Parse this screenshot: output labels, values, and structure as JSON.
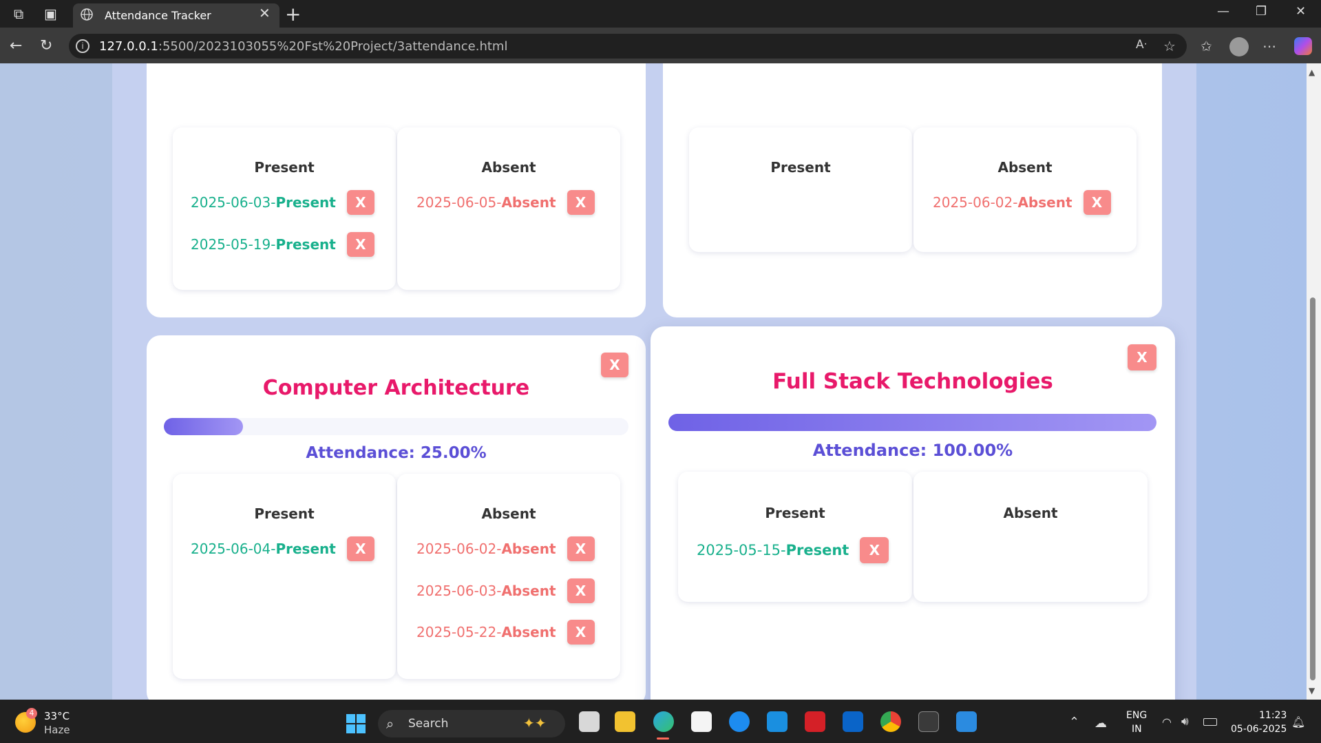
{
  "browser": {
    "tab_title": "Attendance Tracker",
    "url_host": "127.0.0.1",
    "url_rest": ":5500/2023103055%20Fst%20Project/3attendance.html"
  },
  "subjects": [
    {
      "present_label": "Present",
      "absent_label": "Absent",
      "present": [
        "2025-06-03",
        "2025-05-19"
      ],
      "absent": [
        "2025-06-05"
      ]
    },
    {
      "present_label": "Present",
      "absent_label": "Absent",
      "present": [],
      "absent": [
        "2025-06-02"
      ]
    },
    {
      "name": "Computer Architecture",
      "attendance_text": "Attendance: 25.00%",
      "attendance_fraction": 0.25,
      "present_label": "Present",
      "absent_label": "Absent",
      "present": [
        "2025-06-04"
      ],
      "absent": [
        "2025-06-02",
        "2025-06-03",
        "2025-05-22"
      ]
    },
    {
      "name": "Full Stack Technologies",
      "attendance_text": "Attendance: 100.00%",
      "attendance_fraction": 1.0,
      "present_label": "Present",
      "absent_label": "Absent",
      "present": [
        "2025-05-15"
      ],
      "absent": []
    }
  ],
  "entry_words": {
    "present": "Present",
    "absent": "Absent",
    "separator": " - ",
    "delete": "X"
  },
  "taskbar": {
    "weather_temp": "33°C",
    "weather_desc": "Haze",
    "weather_badge": "4",
    "search_placeholder": "Search",
    "lang_top": "ENG",
    "lang_bottom": "IN",
    "time": "11:23",
    "date": "05-06-2025"
  },
  "colors": {
    "present": "#18b08c",
    "absent": "#f0706f",
    "title": "#e8196a",
    "percent": "#5b4fd6",
    "delete_button": "#f88b8b"
  }
}
